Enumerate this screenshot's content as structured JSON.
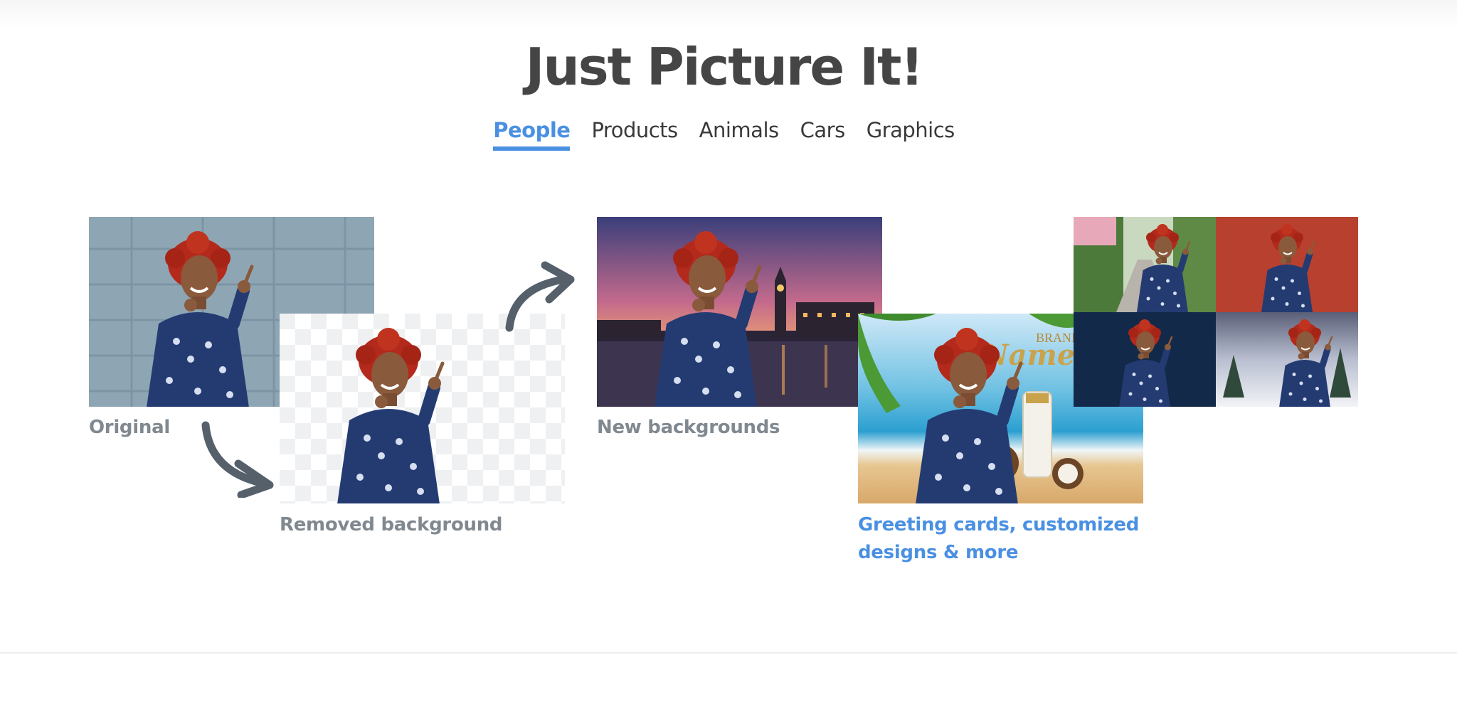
{
  "header": {
    "title": "Just Picture It!"
  },
  "tabs": [
    {
      "label": "People",
      "active": true
    },
    {
      "label": "Products",
      "active": false
    },
    {
      "label": "Animals",
      "active": false
    },
    {
      "label": "Cars",
      "active": false
    },
    {
      "label": "Graphics",
      "active": false
    }
  ],
  "captions": {
    "original": "Original",
    "removed": "Removed background",
    "new_backgrounds": "New backgrounds",
    "greeting_line1": "Greeting cards, customized",
    "greeting_line2": "designs & more"
  },
  "card_text": {
    "brand": "BRAND",
    "name": "Name"
  },
  "colors": {
    "accent": "#4a90e2",
    "title": "#454545",
    "caption": "#808890",
    "arrow": "#55606b"
  }
}
